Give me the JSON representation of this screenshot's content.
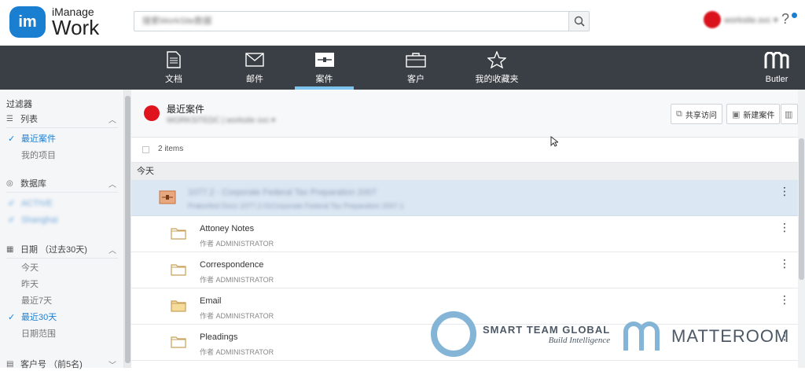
{
  "header": {
    "logo_mark": "im",
    "logo_small": "iManage",
    "logo_big": "Work",
    "search_placeholder": "搜索WorkSite数据",
    "user_name": "worksite.svc ▾",
    "help_label": "?"
  },
  "nav": {
    "tabs": [
      {
        "label": "文档",
        "icon": "document-icon"
      },
      {
        "label": "邮件",
        "icon": "mail-icon"
      },
      {
        "label": "案件",
        "icon": "matter-icon",
        "active": true
      },
      {
        "label": "客户",
        "icon": "briefcase-icon"
      },
      {
        "label": "我的收藏夹",
        "icon": "star-icon"
      }
    ],
    "butler_label": "Butler"
  },
  "sidebar": {
    "title": "过滤器",
    "list_section": {
      "label": "列表",
      "items": [
        {
          "label": "最近案件",
          "checked": true
        },
        {
          "label": "我的项目",
          "checked": false
        }
      ]
    },
    "database_section": {
      "label": "数据库",
      "items": [
        {
          "label": "ACTIVE",
          "checked": true
        },
        {
          "label": "Shanghai",
          "checked": true
        }
      ]
    },
    "date_section": {
      "label": "日期 （过去30天)",
      "items": [
        {
          "label": "今天",
          "checked": false
        },
        {
          "label": "昨天",
          "checked": false
        },
        {
          "label": "最近7天",
          "checked": false
        },
        {
          "label": "最近30天",
          "checked": true
        },
        {
          "label": "日期范围",
          "checked": false
        }
      ]
    },
    "client_section": {
      "label": "客户号 （前5名)"
    }
  },
  "main": {
    "title": "最近案件",
    "subtitle": "WORKSITEDC | worksite svc ▾",
    "share_button": "共享访问",
    "new_matter_button": "新建案件",
    "items_count": "2 items",
    "group_label": "今天",
    "rows": [
      {
        "title": "1077.2 - Corporate Federal Tax Preparation 2007",
        "subtitle": "Prakorfesl Docs 1077.2.01Corporate Federal Tax Preparation 2007.1",
        "type": "matter",
        "selected": true
      },
      {
        "title": "Attoney Notes",
        "subtitle": "作者 ADMINISTRATOR",
        "type": "folder-empty"
      },
      {
        "title": "Correspondence",
        "subtitle": "作者 ADMINISTRATOR",
        "type": "folder-empty"
      },
      {
        "title": "Email",
        "subtitle": "作者 ADMINISTRATOR",
        "type": "folder-full"
      },
      {
        "title": "Pleadings",
        "subtitle": "作者 ADMINISTRATOR",
        "type": "folder-empty"
      }
    ]
  },
  "watermarks": {
    "stg_line1": "SMART TEAM GLOBAL",
    "stg_line2": "Build Intelligence",
    "matteroom": "MATTEROOM"
  },
  "colors": {
    "nav_bg": "#3a3f45",
    "accent": "#1b7fd1",
    "selected_row": "#dce7f4",
    "tab_underline": "#7cc3ee"
  }
}
